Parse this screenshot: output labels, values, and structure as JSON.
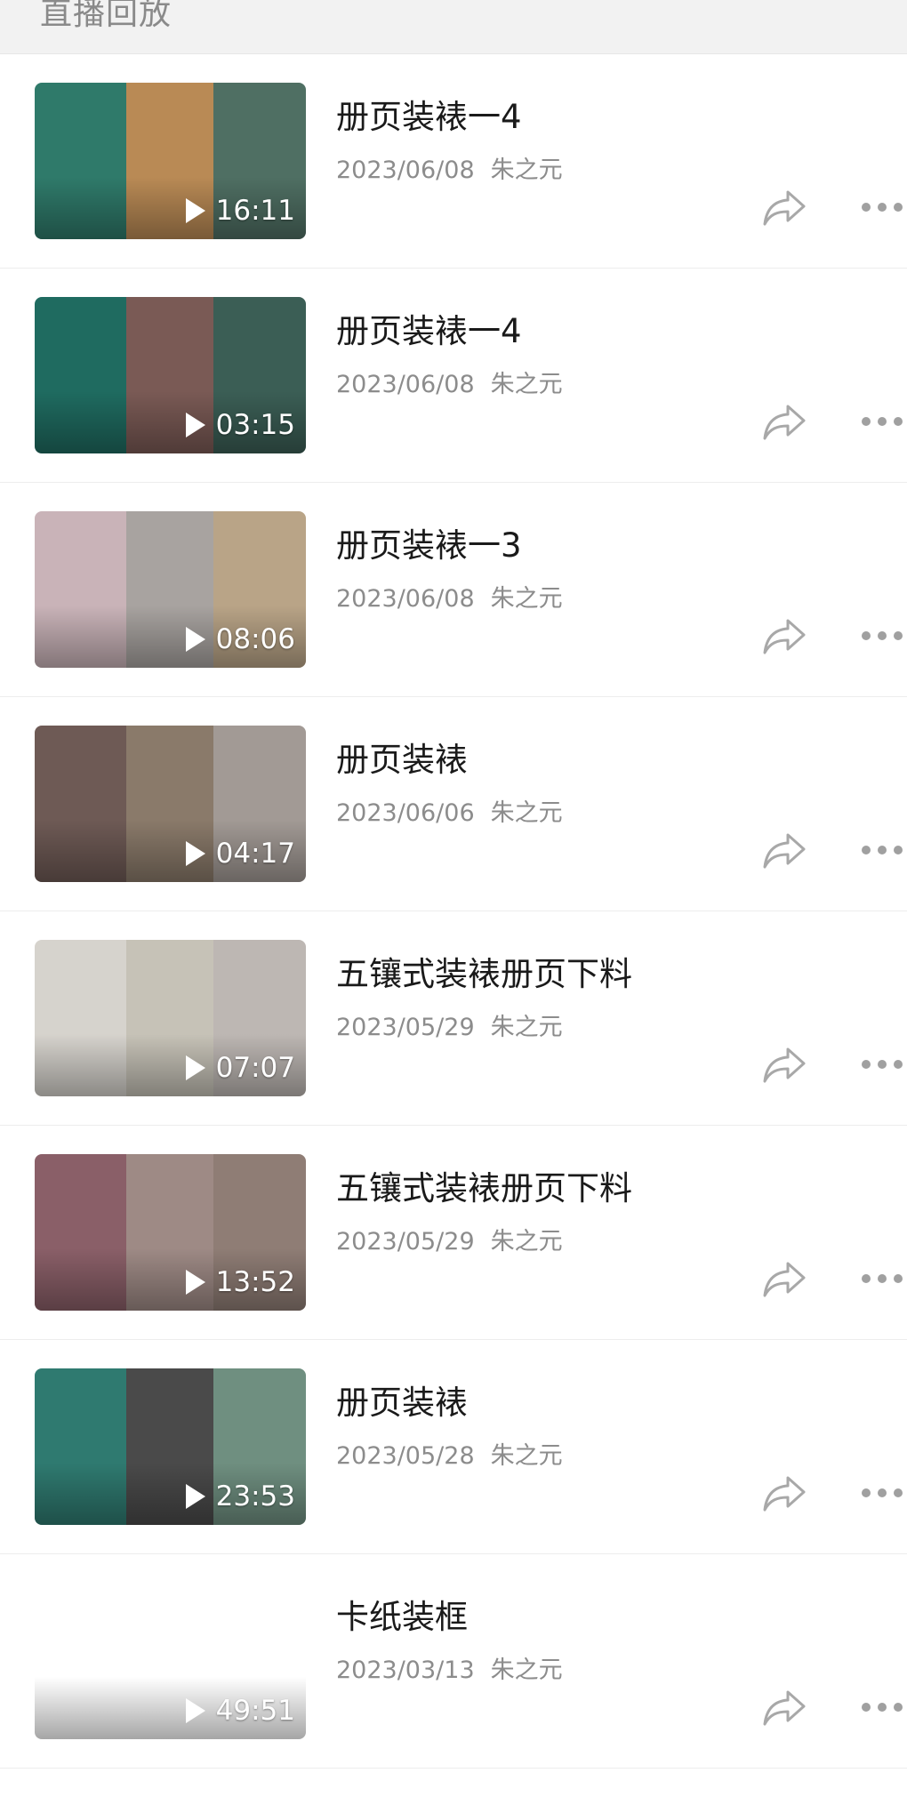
{
  "header": {
    "title": "直播回放"
  },
  "items": [
    {
      "title": "册页装裱一4",
      "date": "2023/06/08",
      "author": "朱之元",
      "duration": "16:11",
      "thumb_colors": [
        "#2f7a6a",
        "#b98a55",
        "#4f6f63"
      ]
    },
    {
      "title": "册页装裱一4",
      "date": "2023/06/08",
      "author": "朱之元",
      "duration": "03:15",
      "thumb_colors": [
        "#1f6b60",
        "#7a5a55",
        "#3b5e55"
      ]
    },
    {
      "title": "册页装裱一3",
      "date": "2023/06/08",
      "author": "朱之元",
      "duration": "08:06",
      "thumb_colors": [
        "#c9b3b8",
        "#a8a3a0",
        "#b9a487"
      ]
    },
    {
      "title": "册页装裱",
      "date": "2023/06/06",
      "author": "朱之元",
      "duration": "04:17",
      "thumb_colors": [
        "#6e5a55",
        "#8a7a6a",
        "#a29a95"
      ]
    },
    {
      "title": "五镶式装裱册页下料",
      "date": "2023/05/29",
      "author": "朱之元",
      "duration": "07:07",
      "thumb_colors": [
        "#d6d3cd",
        "#c6c2b7",
        "#bdb7b3"
      ]
    },
    {
      "title": "五镶式装裱册页下料",
      "date": "2023/05/29",
      "author": "朱之元",
      "duration": "13:52",
      "thumb_colors": [
        "#8a5f68",
        "#9e8a85",
        "#8f7d75"
      ]
    },
    {
      "title": "册页装裱",
      "date": "2023/05/28",
      "author": "朱之元",
      "duration": "23:53",
      "thumb_colors": [
        "#2f7a70",
        "#4a4a4a",
        "#6f8f80"
      ]
    },
    {
      "title": "卡纸装框",
      "date": "2023/03/13",
      "author": "朱之元",
      "duration": "49:51",
      "thumb_colors": [
        "#ffffff",
        "#ffffff",
        "#ffffff"
      ]
    }
  ],
  "icons": {
    "share": "share-icon",
    "more": "more-icon",
    "play": "play-icon"
  }
}
